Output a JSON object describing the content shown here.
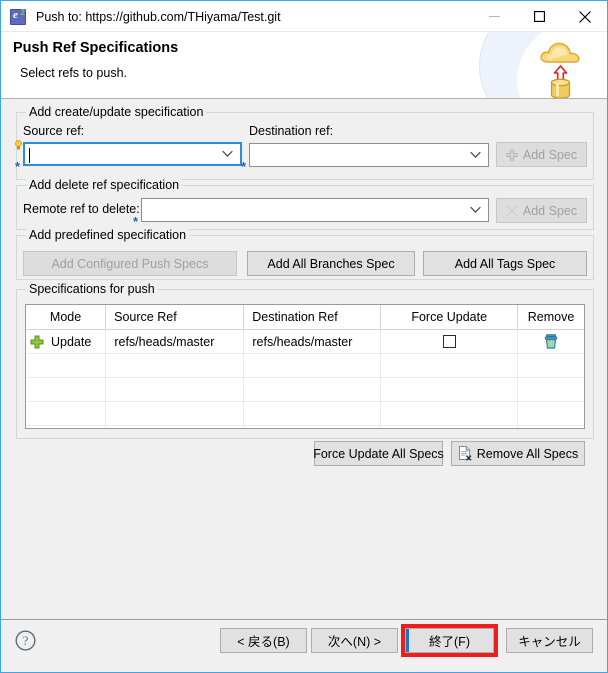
{
  "window": {
    "title": "Push to: https://github.com/THiyama/Test.git",
    "app_icon": "eclipse-icon",
    "minimize_label": "minimize-icon",
    "maximize_label": "maximize-icon",
    "close_label": "close-icon",
    "border_color": "#3ba6e8"
  },
  "banner": {
    "title": "Push Ref Specifications",
    "subtitle": "Select refs to push.",
    "icon": "cloud-upload-database-icon"
  },
  "create_update_group": {
    "legend": "Add create/update specification",
    "source_label": "Source ref:",
    "source_value": "",
    "source_placeholder": "",
    "destination_label": "Destination ref:",
    "destination_value": "",
    "destination_placeholder": "",
    "required_marker": "*",
    "add_spec_label": "Add Spec",
    "add_spec_icon": "plus-icon",
    "add_spec_enabled": false
  },
  "delete_group": {
    "legend": "Add delete ref specification",
    "remote_label": "Remote ref to delete:",
    "remote_value": "",
    "remote_placeholder": "",
    "required_marker": "*",
    "add_spec_label": "Add Spec",
    "add_spec_icon": "cross-icon",
    "add_spec_enabled": false
  },
  "predefined_group": {
    "legend": "Add predefined specification",
    "configured_label": "Add Configured Push Specs",
    "configured_enabled": false,
    "all_branches_label": "Add All Branches Spec",
    "all_tags_label": "Add All Tags Spec"
  },
  "specs_group": {
    "legend": "Specifications for push",
    "columns": [
      "Mode",
      "Source Ref",
      "Destination Ref",
      "Force Update",
      "Remove"
    ],
    "rows": [
      {
        "mode_icon": "green-plus-icon",
        "mode": "Update",
        "source_ref": "refs/heads/master",
        "destination_ref": "refs/heads/master",
        "force_update_checked": false,
        "remove_icon": "trash-icon"
      }
    ],
    "empty_row_count": 6,
    "force_update_all_label": "Force Update All Specs",
    "remove_all_label": "Remove All Specs",
    "remove_all_icon": "document-remove-icon"
  },
  "footer": {
    "help_icon": "help-question-icon",
    "back_label": "< 戻る(B)",
    "back_mnemonic": "B",
    "next_label": "次へ(N) >",
    "next_mnemonic": "N",
    "finish_label": "終了(F)",
    "finish_mnemonic": "F",
    "cancel_label": "キャンセル",
    "highlight_color": "#ef1d1d",
    "focus_color": "#1879c8"
  }
}
